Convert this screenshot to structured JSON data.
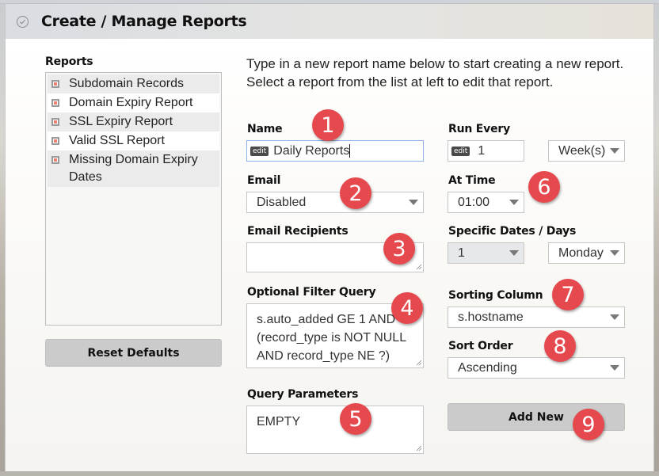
{
  "header": {
    "title": "Create / Manage Reports",
    "icon": "check-circle-icon"
  },
  "reports": {
    "label": "Reports",
    "items": [
      {
        "label": "Subdomain Records"
      },
      {
        "label": "Domain Expiry Report"
      },
      {
        "label": "SSL Expiry Report"
      },
      {
        "label": "Valid SSL Report"
      },
      {
        "label": "Missing Domain Expiry Dates"
      }
    ],
    "reset_button": "Reset Defaults"
  },
  "intro_text": "Type in a new report name below to start creating a new report. Select a report from the list at left to edit that report.",
  "form": {
    "name": {
      "label": "Name",
      "badge": "edit",
      "value": "Daily Reports"
    },
    "email": {
      "label": "Email",
      "value": "Disabled"
    },
    "email_recipients": {
      "label": "Email Recipients",
      "value": ""
    },
    "filter_query": {
      "label": "Optional Filter Query",
      "value": "s.auto_added GE 1 AND (record_type is NOT NULL AND record_type NE ?)"
    },
    "query_parameters": {
      "label": "Query Parameters",
      "value": "EMPTY"
    },
    "run_every": {
      "label": "Run Every",
      "badge": "edit",
      "value": "1",
      "unit": "Week(s)"
    },
    "at_time": {
      "label": "At Time",
      "value": "01:00"
    },
    "specific_dates": {
      "label": "Specific Dates / Days",
      "date_value": "1",
      "day_value": "Monday"
    },
    "sorting_column": {
      "label": "Sorting Column",
      "value": "s.hostname"
    },
    "sort_order": {
      "label": "Sort Order",
      "value": "Ascending"
    },
    "add_button": "Add New"
  },
  "annotations": [
    "1",
    "2",
    "3",
    "4",
    "5",
    "6",
    "7",
    "8",
    "9"
  ],
  "colors": {
    "annotation": "#e5484d",
    "button": "#cbcbcb",
    "focus_border": "#8fb3e6"
  }
}
